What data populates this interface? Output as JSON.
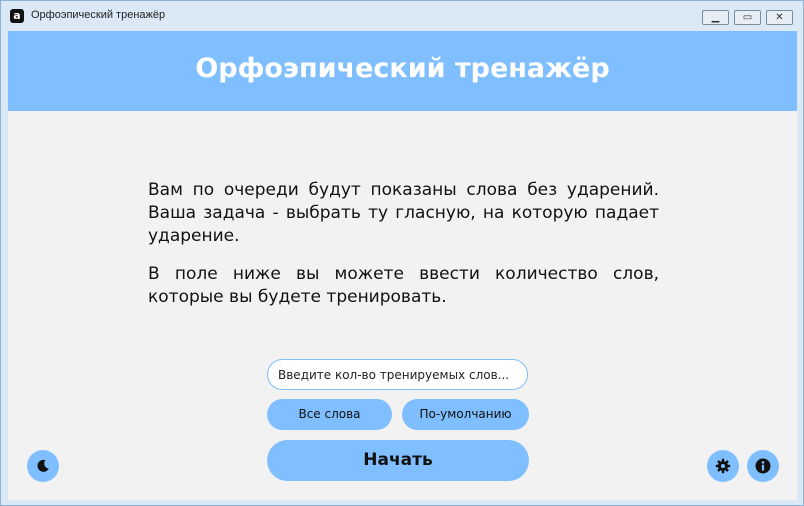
{
  "window": {
    "title": "Орфоэпический тренажёр",
    "app_icon_letter": "a",
    "controls": {
      "minimize": "▁",
      "maximize": "▭",
      "close": "✕"
    }
  },
  "header": {
    "title": "Орфоэпический тренажёр"
  },
  "description": {
    "paragraph1": "Вам по очереди будут показаны слова без ударений. Ваша задача - выбрать ту гласную, на которую падает ударение.",
    "paragraph2": "В поле ниже вы можете ввести количество слов, которые вы будете тренировать."
  },
  "controls": {
    "count_placeholder": "Введите кол-во тренируемых слов...",
    "count_value": "",
    "all_words_label": "Все слова",
    "default_label": "По-умолчанию",
    "start_label": "Начать"
  },
  "icons": {
    "theme": "moon-icon",
    "settings": "gear-icon",
    "info": "info-icon"
  },
  "colors": {
    "accent": "#80bfff",
    "background": "#f2f2f2",
    "titlebar": "#dbe9f7"
  }
}
